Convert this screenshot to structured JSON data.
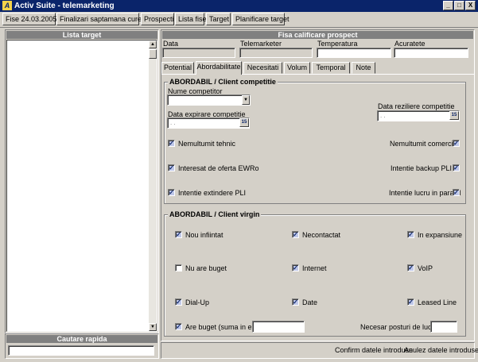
{
  "window": {
    "title": "Activ Suite - telemarketing",
    "icon": "app-logo-icon",
    "controls": [
      "_",
      "□",
      "X"
    ]
  },
  "toolbar": {
    "buttons": [
      "Fise 24.03.2005",
      "Finalizari saptamana curenta",
      "Prospecti",
      "Lista fise",
      "Target",
      "Planificare target"
    ]
  },
  "left": {
    "list_header": "Lista target",
    "search_header": "Cautare rapida",
    "search_value": ""
  },
  "form": {
    "header": "Fisa calificare prospect",
    "fields": {
      "data_label": "Data",
      "telemarketer_label": "Telemarketer",
      "temperatura_label": "Temperatura",
      "acuratete_label": "Acuratete"
    },
    "tabs": [
      "Potential",
      "Abordabilitate",
      "Necesitati",
      "Volum",
      "Temporal",
      "Note"
    ],
    "active_tab": "Abordabilitate"
  },
  "competitie": {
    "title": "ABORDABIL / Client competitie",
    "nume_label": "Nume competitor",
    "expirare_label": "Data expirare competitie",
    "expirare_value": " .  .",
    "reziliere_label": "Data reziliere competitie",
    "reziliere_value": " .  .",
    "cal_icon": "15",
    "checks": [
      {
        "label": "Nemultumit tehnic",
        "checked": true
      },
      {
        "label": "Nemultumit comercial",
        "checked": true
      },
      {
        "label": "Interesat de oferta EWRo",
        "checked": true
      },
      {
        "label": "Intentie backup PLI",
        "checked": true
      },
      {
        "label": "Intentie extindere PLI",
        "checked": true
      },
      {
        "label": "Intentie lucru in paralel",
        "checked": true
      }
    ]
  },
  "virgin": {
    "title": "ABORDABIL / Client virgin",
    "checks": [
      {
        "label": "Nou infiintat",
        "checked": true
      },
      {
        "label": "Necontactat",
        "checked": true
      },
      {
        "label": "In expansiune",
        "checked": true
      },
      {
        "label": "Nu are buget",
        "checked": false
      },
      {
        "label": "Internet",
        "checked": true
      },
      {
        "label": "VoIP",
        "checked": true
      },
      {
        "label": "Dial-Up",
        "checked": true
      },
      {
        "label": "Date",
        "checked": true
      },
      {
        "label": "Leased Line",
        "checked": true
      },
      {
        "label": "Are buget (suma in euro",
        "checked": true
      }
    ],
    "necesar_label": "Necesar posturi de lucru"
  },
  "footer": {
    "confirm": "Confirm datele introduse",
    "cancel": "Anulez datele introduse"
  }
}
